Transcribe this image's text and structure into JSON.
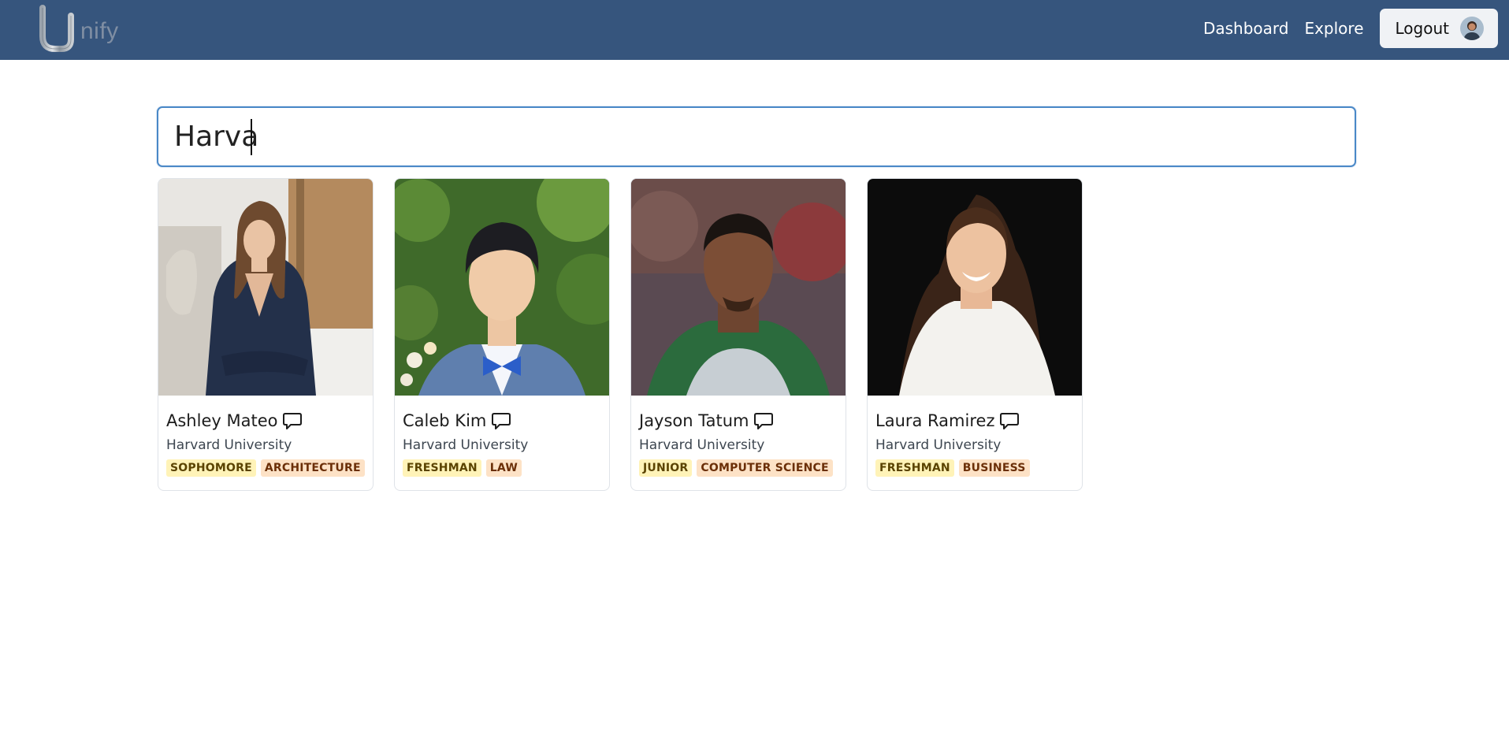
{
  "brand": {
    "logo_letter": "U",
    "text": "nify"
  },
  "nav": {
    "dashboard_label": "Dashboard",
    "explore_label": "Explore",
    "logout_label": "Logout"
  },
  "search": {
    "value": "Harva"
  },
  "colors": {
    "navbar": "#36557d",
    "search_border": "#4a88c7",
    "badge_year_bg": "#fff3b8",
    "badge_major_bg": "#fde2c6"
  },
  "profiles": [
    {
      "name": "Ashley Mateo",
      "school": "Harvard University",
      "year": "SOPHOMORE",
      "major": "ARCHITECTURE"
    },
    {
      "name": "Caleb Kim",
      "school": "Harvard University",
      "year": "FRESHMAN",
      "major": "LAW"
    },
    {
      "name": "Jayson Tatum",
      "school": "Harvard University",
      "year": "JUNIOR",
      "major": "COMPUTER SCIENCE"
    },
    {
      "name": "Laura Ramirez",
      "school": "Harvard University",
      "year": "FRESHMAN",
      "major": "BUSINESS"
    }
  ]
}
